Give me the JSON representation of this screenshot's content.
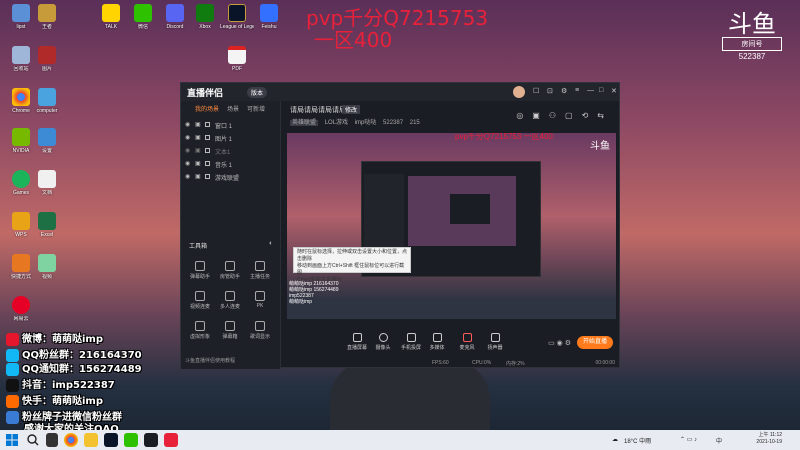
{
  "overlay": {
    "line1": "pvp千分Q7215753",
    "line2": "一区400"
  },
  "brand": {
    "mark": "斗鱼",
    "sub": "房间号",
    "room_no": "522387"
  },
  "desktop_icons": [
    {
      "label": "lipst"
    },
    {
      "label": "王者"
    },
    {
      "label": "TALK"
    },
    {
      "label": "微信"
    },
    {
      "label": "Discord"
    },
    {
      "label": "Xbox"
    },
    {
      "label": "League of Legends"
    },
    {
      "label": "Feishu"
    },
    {
      "label": "PDF"
    },
    {
      "label": "回收站"
    },
    {
      "label": "图片"
    },
    {
      "label": "Chrome"
    },
    {
      "label": "computer"
    },
    {
      "label": "NVIDIA"
    },
    {
      "label": "设置"
    },
    {
      "label": "Games"
    },
    {
      "label": "文档"
    },
    {
      "label": "WPS"
    },
    {
      "label": "Excel"
    },
    {
      "label": "快捷方式"
    },
    {
      "label": "视频"
    },
    {
      "label": "网易云"
    }
  ],
  "stream_info": [
    {
      "prefix": "微博：",
      "value": "萌萌哒imp",
      "icon_color": "#e6162d"
    },
    {
      "prefix": "QQ粉丝群：",
      "value": "216164370",
      "icon_color": "#12b7f5"
    },
    {
      "prefix": "QQ通知群：",
      "value": "156274489",
      "icon_color": "#12b7f5"
    },
    {
      "prefix": "抖音：",
      "value": "imp522387",
      "icon_color": "#111111"
    },
    {
      "prefix": "快手：",
      "value": "萌萌哒imp",
      "icon_color": "#ff6a00"
    },
    {
      "prefix": "",
      "value": "粉丝牌子进微信粉丝群",
      "icon_color": "#3a7bd5"
    },
    {
      "prefix": "",
      "value": "感谢大家的关注QAQ",
      "icon_color": ""
    }
  ],
  "app": {
    "logo": "直播伴侣",
    "version": "版本",
    "controls": [
      "☐",
      "⊡",
      "⚙",
      "≡",
      "—",
      "□",
      "✕"
    ],
    "tabs": [
      "我的场景",
      "场景",
      "可新增"
    ],
    "sources": [
      {
        "name": "窗口 1"
      },
      {
        "name": "图片 1"
      },
      {
        "name": "文本1"
      },
      {
        "name": "音乐 1"
      },
      {
        "name": "游戏联盟"
      }
    ],
    "tool_title": "工具箱",
    "tools": [
      {
        "label": "弹幕助手"
      },
      {
        "label": "房管助手"
      },
      {
        "label": "主播任务"
      },
      {
        "label": "视频连麦"
      },
      {
        "label": "多人连麦"
      },
      {
        "label": "PK"
      },
      {
        "label": "虚拟形象"
      },
      {
        "label": "弹幕箱"
      },
      {
        "label": "歌词显示"
      }
    ],
    "sidebar_footer": "斗鱼直播伴侣使用教程",
    "room_title": "请局请局请局请局",
    "room_edit": "修改",
    "room_meta": {
      "tag": "英雄联盟",
      "category": "LOL游戏",
      "name": "imp哒哒",
      "room": "522387",
      "viewers": "215"
    },
    "preview": {
      "overlay": "pvp千分Q7215753 一区400",
      "brand": "斗鱼",
      "tip_lines": [
        "随时在鼠标选择，拉伸或双击设置大小和位置，点击删除",
        "移动到画面上方Ctrl+Shift 框住鼠标位可以进行截图",
        "Ctrl+V粘贴文本/图片"
      ],
      "chat_lines": [
        "萌萌哒imp 216164370",
        "萌萌哒imp 156274489",
        "imp522387",
        "萌萌哒imp"
      ]
    },
    "bottom_buttons": [
      {
        "label": "直播屏幕"
      },
      {
        "label": "摄像头"
      },
      {
        "label": "手机投屏"
      },
      {
        "label": "多媒体"
      },
      {
        "label": "麦克风"
      },
      {
        "label": "扬声器"
      }
    ],
    "live_button": "开始直播",
    "status": {
      "left": "",
      "fps": "FPS:60",
      "cpu": "CPU:0%",
      "mem": "内存:2%",
      "time": "00:00:00"
    }
  },
  "taskbar": {
    "search_icon": "search",
    "weather": "18°C 中雨",
    "lang": "中",
    "time": "上午 11:12",
    "date": "2021-10-19"
  }
}
